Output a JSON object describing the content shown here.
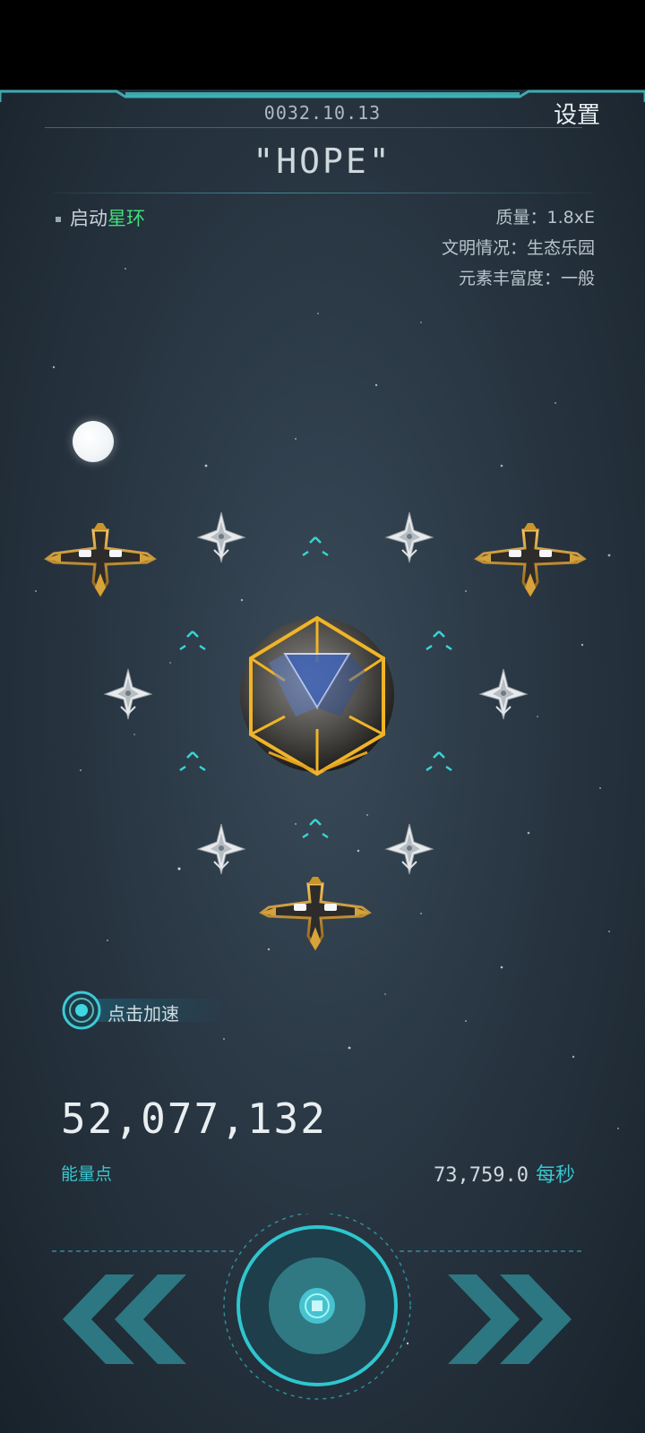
{
  "header": {
    "date": "0032.10.13",
    "settings_label": "设置",
    "planet_name": "\"HOPE\""
  },
  "left_panel": {
    "start_ring_prefix": "启动",
    "start_ring_highlight": "星环"
  },
  "stats": {
    "mass": "质量：1.8xE",
    "civilization": "文明情况：生态乐园",
    "element_richness": "元素丰富度：一般"
  },
  "boost": {
    "label": "点击加速"
  },
  "resources": {
    "energy_value": "52,077,132",
    "energy_label": "能量点",
    "rate_value": "73,759.0",
    "rate_unit": "每秒"
  },
  "icons": {
    "prev": "double-chevron-left-icon",
    "next": "double-chevron-right-icon",
    "center": "main-core-button",
    "boost": "boost-ring-icon"
  },
  "colors": {
    "accent": "#38c6cf",
    "highlight_green": "#3ee07a",
    "ship_gold": "#c9952b",
    "core_gold": "#f0b428"
  }
}
